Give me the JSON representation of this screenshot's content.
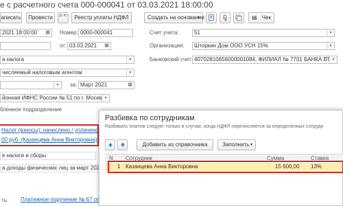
{
  "window": {
    "title": "е с расчетного счета 000-000041 от 03.03.2021 18:00:00"
  },
  "toolbar": {
    "save_label": "аписать",
    "post_label": "Провести",
    "dt_kt_label": "Дт Кт",
    "ndfl_register_label": "Реестр уплаты НДФЛ",
    "create_basis_label": "Создать на основании",
    "check_label": "Чек"
  },
  "form": {
    "date_value": "2021 18:00:00",
    "number_label": "Номер:",
    "number_value": "0000-000041",
    "from_label": "от:",
    "from_date_value": "03.03.2021",
    "account_label": "Счет учета:",
    "account_value": "51",
    "org_label": "Организация:",
    "org_value": "Шторкин Дом ООО УСН 15%",
    "bank_account_label": "Банковский счет:",
    "bank_account_value": "40702810656000001084, ФИЛИАЛ № 7701 БАНКА ВТБ (ПА",
    "tax_type_value": "а налога",
    "tax_withheld_value": "числяемый налоговым агентом",
    "period_label": "за:",
    "period_value": "Март 2021",
    "ifns_value": "йонная ИФНС России № 51 по г. Москве",
    "subdivision_label": "бленное подразделение",
    "tax_link": "Налог (взносы): начислено / уплачено",
    "amount_link": "00 руб. (Казанцева Анна Викторовна)",
    "section_taxes": "е налоги и сборы",
    "income_tax_value": "а доходы физических лиц за март 2021 ",
    "bottom_label": "ть:",
    "bottom_link": "Платежное поручение № 67 от 03.03"
  },
  "dialog": {
    "title": "Разбивка по сотрудникам",
    "hint": "Разбивать платеж следует только в случае, когда НДФЛ перечисляется за определенных сотрудн",
    "up_icon": "arrow-up-icon",
    "down_icon": "arrow-down-icon",
    "add_from_directory_label": "Добавить из справочника",
    "fill_label": "Заполнить",
    "columns": {
      "num": "N",
      "employee": "Сотрудник",
      "amount": "Сумма",
      "rate": "Ставка"
    },
    "rows": [
      {
        "num": "1",
        "employee": "Казанцева Анна Викторовна",
        "amount": "15 600,00",
        "rate": "13%"
      }
    ]
  },
  "colors": {
    "highlight": "#e02020",
    "link": "#1f5fab",
    "selected_row": "#fbeeae",
    "nav_arrow": "#2b7fd6"
  }
}
